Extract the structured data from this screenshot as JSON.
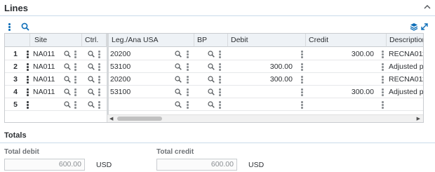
{
  "section": {
    "title": "Lines"
  },
  "grid": {
    "columns": [
      "Site",
      "Ctrl.",
      "Leg./Ana USA",
      "BP",
      "Debit",
      "Credit",
      "Description"
    ],
    "rows": [
      {
        "num": "1",
        "site": "NA011",
        "account": "20200",
        "debit": "",
        "credit": "300.00",
        "description": "RECNA0110"
      },
      {
        "num": "2",
        "site": "NA011",
        "account": "53100",
        "debit": "300.00",
        "credit": "",
        "description": "Adjusted pu"
      },
      {
        "num": "3",
        "site": "NA011",
        "account": "20200",
        "debit": "300.00",
        "credit": "",
        "description": "RECNA0110"
      },
      {
        "num": "4",
        "site": "NA011",
        "account": "53100",
        "debit": "",
        "credit": "300.00",
        "description": "Adjusted pu"
      },
      {
        "num": "5",
        "site": "",
        "account": "",
        "debit": "",
        "credit": "",
        "description": ""
      }
    ]
  },
  "totals": {
    "title": "Totals",
    "debit_label": "Total debit",
    "debit_value": "600.00",
    "debit_currency": "USD",
    "credit_label": "Total credit",
    "credit_value": "600.00",
    "credit_currency": "USD"
  },
  "colors": {
    "accent": "#0e6eb8",
    "header_bg": "#eef2f6",
    "rule": "#c9dbea"
  }
}
